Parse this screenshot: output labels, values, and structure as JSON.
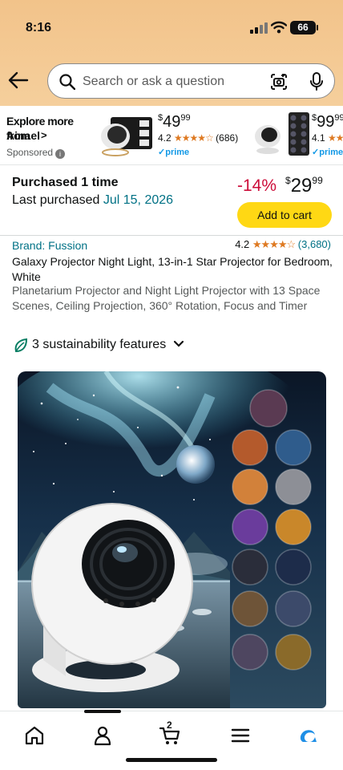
{
  "status": {
    "time": "8:16",
    "battery": "66"
  },
  "search": {
    "placeholder": "Search or ask a question"
  },
  "ad": {
    "title": "Explore more from",
    "brand": "Ainael",
    "sponsored": "Sponsored",
    "products": [
      {
        "currency": "$",
        "dollars": "49",
        "cents": "99",
        "rating": "4.2",
        "stars": "★★★★☆",
        "count": "(686)",
        "prime": "prime"
      },
      {
        "currency": "$",
        "dollars": "99",
        "cents": "99",
        "rating": "4.1",
        "stars": "★★★★",
        "count": "",
        "prime": "prime"
      }
    ]
  },
  "purchase": {
    "line1": "Purchased 1 time",
    "line2_prefix": "Last purchased",
    "line2_date": "Jul 15, 2026",
    "discount": "-14%",
    "currency": "$",
    "dollars": "29",
    "cents": "99",
    "add_to_cart": "Add to cart"
  },
  "product": {
    "brand": "Brand: Fussion",
    "rating": "4.2",
    "stars": "★★★★☆",
    "rating_count": "(3,680)",
    "title": "Galaxy Projector Night Light, 13-in-1 Star Projector for Bedroom, White",
    "subtitle": "Planetarium Projector and Night Light Projector with 13 Space Scenes, Ceiling Projection, 360° Rotation, Focus and Timer",
    "sustainability": "3 sustainability features"
  },
  "hero_scene": {
    "sky": "#0c1a2c",
    "aurora": "#8fe6ff",
    "mountain": "#223a48",
    "water": "#4e6a7c",
    "device": "#f3f3f3"
  },
  "tabbar": {
    "cart_count": "2",
    "active_tab": "account",
    "tabs": [
      "home-icon",
      "account-icon",
      "cart-icon",
      "menu-icon",
      "ai-assistant-icon"
    ]
  }
}
